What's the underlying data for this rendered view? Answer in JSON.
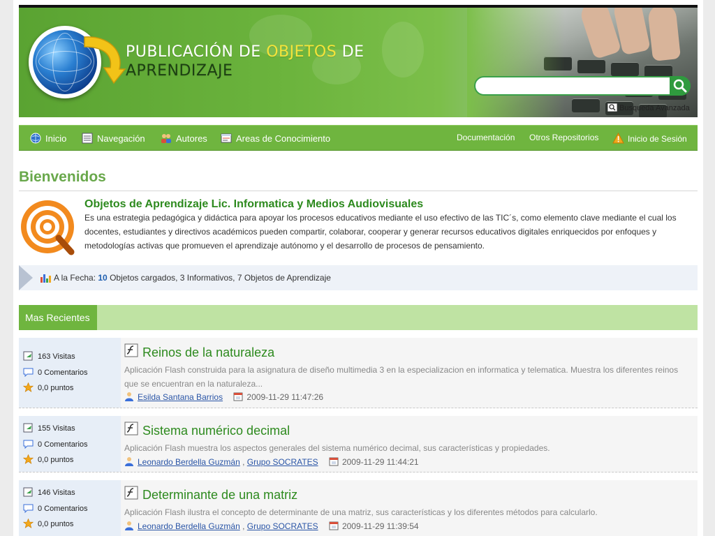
{
  "header": {
    "title_part1": "PUBLICACIÓN DE ",
    "title_accent": "OBJETOS",
    "title_part2": " DE",
    "title_line2": "APRENDIZAJE",
    "search_value": "",
    "search_placeholder": "",
    "advanced_search": "Busqueda Avanzada"
  },
  "nav": {
    "left": [
      {
        "label": "Inicio",
        "icon": "globe-icon"
      },
      {
        "label": "Navegación",
        "icon": "list-icon"
      },
      {
        "label": "Autores",
        "icon": "users-icon"
      },
      {
        "label": "Areas de Conocimiento",
        "icon": "folder-icon"
      }
    ],
    "right": [
      {
        "label": "Documentación"
      },
      {
        "label": "Otros Repositorios"
      },
      {
        "label": "Inicio de Sesión",
        "icon": "warning-icon"
      }
    ]
  },
  "welcome": {
    "title": "Bienvenidos",
    "heading": "Objetos de Aprendizaje Lic. Informatica y Medios Audiovisuales",
    "text": "Es una estrategia pedagógica y didáctica para apoyar los procesos educativos mediante el uso efectivo de las TIC´s, como elemento clave mediante el cual los docentes, estudiantes y directivos académicos pueden compartir, colaborar, cooperar  y generar recursos educativos digitales enriquecidos por enfoques y metodologías activas que promueven el aprendizaje autónomo y el desarrollo de procesos de pensamiento."
  },
  "stats": {
    "prefix": "A la Fecha: ",
    "count": "10",
    "suffix": " Objetos cargados, 3 Informativos, 7 Objetos de Aprendizaje"
  },
  "recent": {
    "tab_label": "Mas Recientes",
    "items": [
      {
        "title": "Reinos de la naturaleza",
        "visits": "163 Visitas",
        "comments": "0 Comentarios",
        "points": "0,0 puntos",
        "description": "Aplicación Flash construida para la asignatura de diseño multimedia 3 en la especializacion en informatica y telematica. Muestra los diferentes reinos que se encuentran en la naturaleza...",
        "author1": "Esilda Santana Barrios",
        "author2": "",
        "date": "2009-11-29 11:47:26"
      },
      {
        "title": "Sistema numérico decimal",
        "visits": "155 Visitas",
        "comments": "0 Comentarios",
        "points": "0,0 puntos",
        "description": "Aplicación Flash muestra los aspectos generales del sistema numérico decimal, sus características y propiedades.",
        "author1": "Leonardo Berdella Guzmán",
        "author2": "Grupo SOCRATES",
        "date": "2009-11-29 11:44:21"
      },
      {
        "title": "Determinante de una matriz",
        "visits": "146 Visitas",
        "comments": "0 Comentarios",
        "points": "0,0 puntos",
        "description": "Aplicación Flash ilustra el concepto de determinante de una matriz, sus características y los diferentes métodos para calcularlo.",
        "author1": "Leonardo Berdella Guzmán",
        "author2": "Grupo SOCRATES",
        "date": "2009-11-29 11:39:54"
      }
    ]
  },
  "colors": {
    "brand_green": "#6fb53f",
    "title_green": "#2d8a1e",
    "link_blue": "#2a55a6",
    "accent_yellow": "#f4e43a"
  }
}
